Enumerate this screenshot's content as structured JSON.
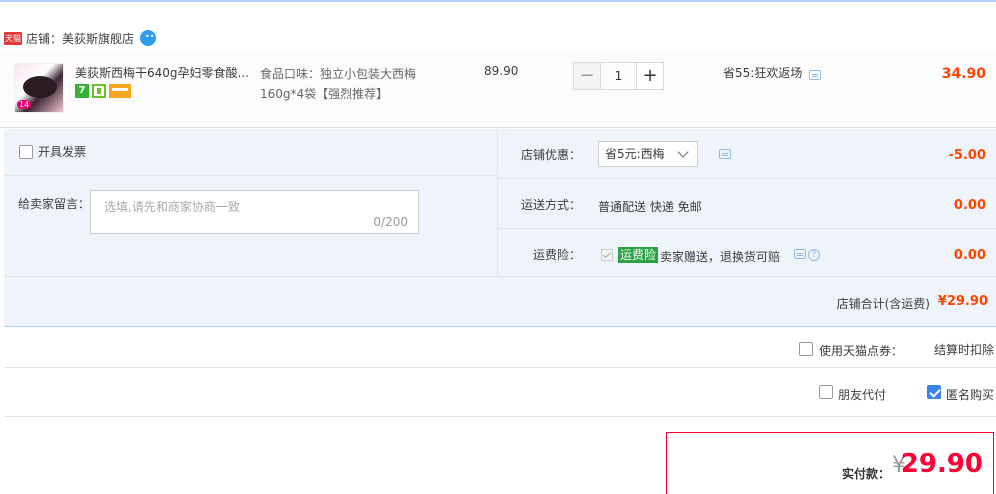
{
  "shop": {
    "badge": "天猫",
    "label": "店铺：",
    "name": "美荻斯旗舰店"
  },
  "item": {
    "title": "美荻斯西梅干640g孕妇零食酸...",
    "sku": "食品口味：独立小包装大西梅160g*4袋【强烈推荐】",
    "price": "89.90",
    "quantity": "1",
    "qty_minus": "−",
    "qty_plus": "+",
    "promo": "省55:狂欢返场",
    "subtotal": "34.90"
  },
  "options": {
    "invoice_label": "开具发票",
    "memo_label": "给卖家留言：",
    "memo_placeholder": "选填,请先和商家协商一致",
    "memo_count": "0/200",
    "coupon_label": "店铺优惠：",
    "coupon_value": "省5元:西梅",
    "coupon_amount": "-5.00",
    "shipping_label": "运送方式：",
    "shipping_value": "普通配送 快递 免邮",
    "shipping_amount": "0.00",
    "insurance_label": "运费险：",
    "insurance_tag": "运费险",
    "insurance_text": "卖家赠送，退换货可赔",
    "insurance_amount": "0.00"
  },
  "shop_total": {
    "label": "店铺合计(含运费)",
    "value": "¥29.90"
  },
  "points": {
    "label": "使用天猫点券：",
    "value": "结算时扣除"
  },
  "purchase_options": {
    "friend_pay": "朋友代付",
    "anonymous": "匿名购买",
    "anonymous_checked": true,
    "friend_checked": false
  },
  "payment": {
    "label": "实付款：",
    "currency": "¥",
    "amount": "29.90"
  },
  "colors": {
    "accent_red": "#ff0036",
    "price_orange": "#ff4400",
    "panel_blue": "#eff4fa",
    "checkbox_blue": "#3a83e8"
  }
}
